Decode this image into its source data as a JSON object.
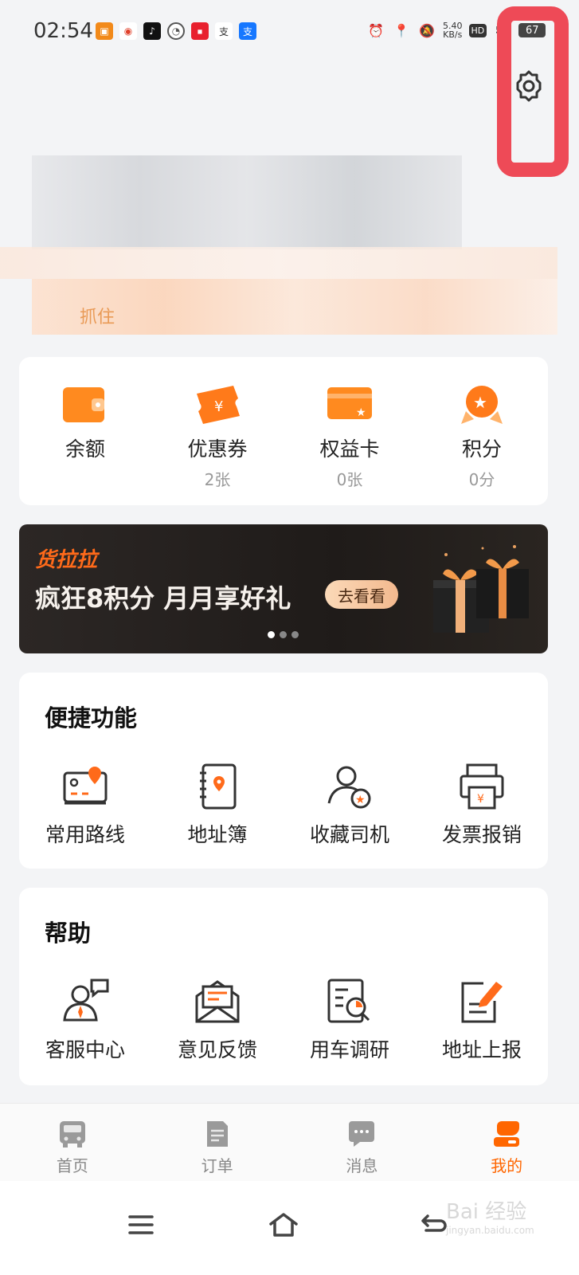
{
  "status": {
    "time": "02:54",
    "net_speed": "5.40",
    "net_unit": "KB/s",
    "hd": "HD",
    "signal": "5G",
    "battery": "67"
  },
  "profile": {
    "hint": "抓住"
  },
  "wallet": {
    "items": [
      {
        "label": "余额",
        "sub": ""
      },
      {
        "label": "优惠券",
        "sub": "2张"
      },
      {
        "label": "权益卡",
        "sub": "0张"
      },
      {
        "label": "积分",
        "sub": "0分"
      }
    ]
  },
  "banner": {
    "logo": "货拉拉",
    "title": "疯狂8积分 月月享好礼",
    "button": "去看看"
  },
  "shortcuts": {
    "title": "便捷功能",
    "items": [
      {
        "label": "常用路线",
        "icon": "route-map-icon"
      },
      {
        "label": "地址簿",
        "icon": "address-book-icon"
      },
      {
        "label": "收藏司机",
        "icon": "favorite-driver-icon"
      },
      {
        "label": "发票报销",
        "icon": "invoice-printer-icon"
      }
    ]
  },
  "help": {
    "title": "帮助",
    "items": [
      {
        "label": "客服中心",
        "icon": "customer-service-icon"
      },
      {
        "label": "意见反馈",
        "icon": "feedback-icon"
      },
      {
        "label": "用车调研",
        "icon": "survey-icon"
      },
      {
        "label": "地址上报",
        "icon": "address-report-icon"
      }
    ]
  },
  "tabbar": {
    "items": [
      {
        "label": "首页",
        "icon": "truck-icon"
      },
      {
        "label": "订单",
        "icon": "order-icon"
      },
      {
        "label": "消息",
        "icon": "message-icon"
      },
      {
        "label": "我的",
        "icon": "profile-icon"
      }
    ],
    "active": "我的"
  },
  "watermark": {
    "text": "Bai 经验",
    "sub": "jingyan.baidu.com"
  },
  "colors": {
    "accent": "#ff6600",
    "highlight": "#ee4a57"
  }
}
